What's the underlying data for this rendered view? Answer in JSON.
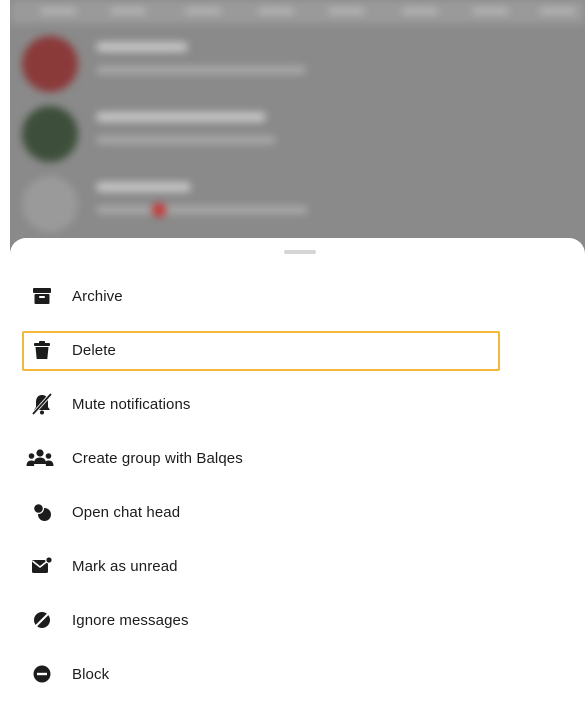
{
  "background_chat_list": {
    "dimmed": true,
    "blurred": true,
    "avatar_colors": [
      "#8b3a3a",
      "#3d4f3a",
      "#9a9a9a"
    ],
    "reaction_color": "#c63a3a"
  },
  "sheet": {
    "items": [
      {
        "label": "Archive",
        "icon": "archive-icon"
      },
      {
        "label": "Delete",
        "icon": "trash-icon"
      },
      {
        "label": "Mute notifications",
        "icon": "bell-off-icon"
      },
      {
        "label": "Create group with Balqes",
        "icon": "group-icon"
      },
      {
        "label": "Open chat head",
        "icon": "chat-head-icon"
      },
      {
        "label": "Mark as unread",
        "icon": "mark-unread-icon"
      },
      {
        "label": "Ignore messages",
        "icon": "ignore-icon"
      },
      {
        "label": "Block",
        "icon": "block-icon"
      }
    ],
    "highlighted_item": "Delete",
    "highlight_color": "#f5b73b",
    "text_color": "#1c1c1c"
  }
}
